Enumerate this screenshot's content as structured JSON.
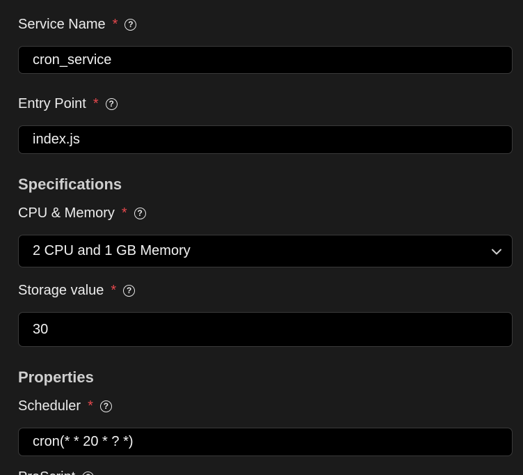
{
  "fields": {
    "service_name": {
      "label": "Service Name",
      "required": "*",
      "value": "cron_service"
    },
    "entry_point": {
      "label": "Entry Point",
      "required": "*",
      "value": "index.js"
    },
    "cpu_memory": {
      "label": "CPU & Memory",
      "required": "*",
      "selected": "2 CPU and 1 GB Memory"
    },
    "storage": {
      "label": "Storage value",
      "required": "*",
      "value": "30"
    },
    "scheduler": {
      "label": "Scheduler",
      "required": "*",
      "value": "cron(* * 20 * ? *)"
    },
    "pre_script": {
      "label": "PreScript"
    }
  },
  "sections": {
    "specifications": "Specifications",
    "properties": "Properties"
  },
  "help_glyph": "?",
  "colors": {
    "background": "#1b1b1b",
    "input_background": "#000000",
    "required_star": "#e5484d"
  },
  "icons": [
    "help-circle-icon",
    "chevron-down-icon"
  ]
}
